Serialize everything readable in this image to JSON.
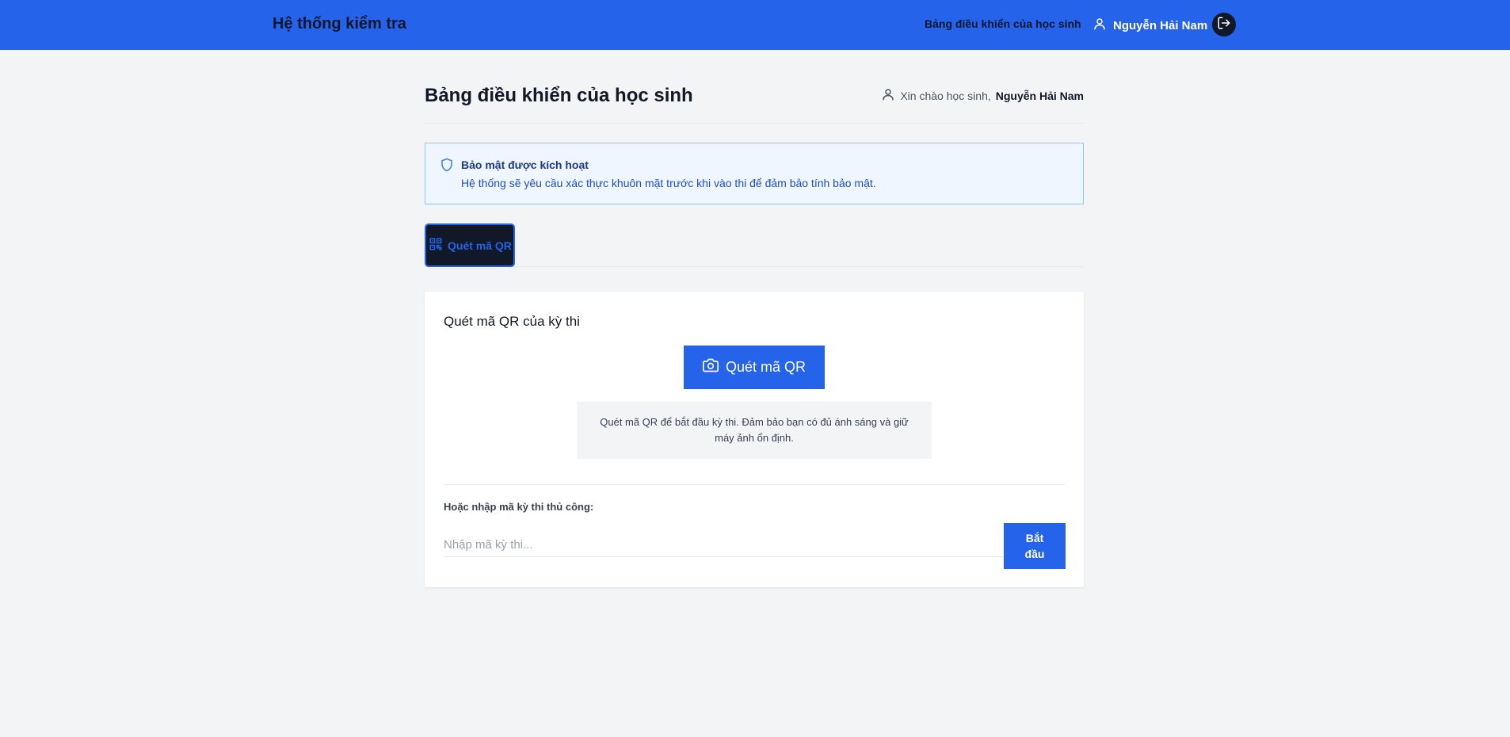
{
  "navbar": {
    "brand": "Hệ thống kiểm tra",
    "dashboard_link": "Bảng điều khiển của học sinh",
    "user_name": "Nguyễn Hải Nam"
  },
  "page": {
    "title": "Bảng điều khiển của học sinh",
    "greeting_prefix": "Xin chào học sinh,",
    "greeting_name": "Nguyễn Hải Nam"
  },
  "security": {
    "title": "Bảo mật được kích hoạt",
    "description": "Hệ thống sẽ yêu cầu xác thực khuôn mặt trước khi vào thi để đảm bảo tính bảo mật."
  },
  "tabs": [
    {
      "label": "Quét mã QR",
      "active": true
    }
  ],
  "scan_card": {
    "title": "Quét mã QR của kỳ thi",
    "scan_button": "Quét mã QR",
    "tip": "Quét mã QR để bắt đầu kỳ thi. Đảm bảo bạn có đủ ánh sáng và giữ máy ảnh ổn định.",
    "manual_label": "Hoặc nhập mã kỳ thi thủ công:",
    "code_placeholder": "Nhập mã kỳ thi...",
    "code_value": "",
    "start_button": "Bắt đầu"
  },
  "colors": {
    "primary": "#2563eb",
    "dark": "#111827",
    "background": "#f3f4f6",
    "info_bg": "#eff6ff",
    "info_border": "#93c5fd"
  },
  "icons": {
    "user": "user-icon",
    "logout": "logout-icon",
    "shield": "shield-icon",
    "qr": "qr-code-icon",
    "camera": "camera-icon"
  }
}
